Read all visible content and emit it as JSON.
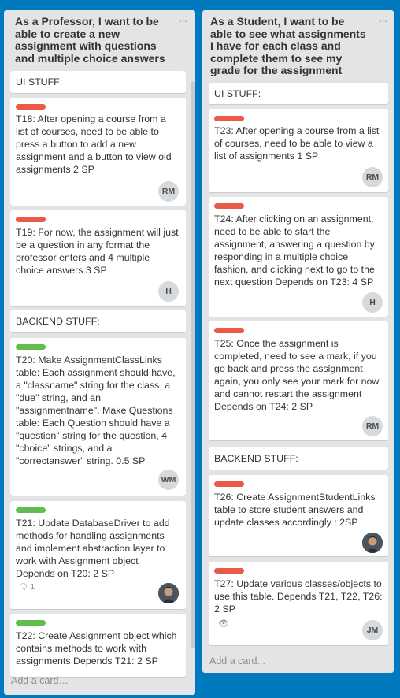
{
  "lists": [
    {
      "title": "As a Professor, I want to be able to create a new assignment with questions and multiple choice answers",
      "menu": "···",
      "cards": [
        {
          "title": "UI STUFF:"
        },
        {
          "title": "T18: After opening a course from a list of courses, need to be able to press a button to add a new assignment and a button to view old assignments 2 SP",
          "label_color": "#eb5a46",
          "avatar": "RM"
        },
        {
          "title": "T19: For now, the assignment will just be a question in any format the professor enters and 4 multiple choice answers 3 SP",
          "label_color": "#eb5a46",
          "avatar": "H"
        },
        {
          "title": "BACKEND STUFF:"
        },
        {
          "title": "T20: Make AssignmentClassLinks table: Each assignment should have, a \"classname\" string for the class, a \"due\" string, and an \"assignmentname\". Make Questions table: Each Question should have a \"question\" string for the question, 4 \"choice\" strings, and a \"correctanswer\" string. 0.5 SP",
          "label_color": "#61bd4f",
          "avatar": "WM"
        },
        {
          "title": "T21: Update DatabaseDriver to add methods for handling assignments and implement abstraction layer to work with Assignment object Depends on T20: 2 SP",
          "label_color": "#61bd4f",
          "comments": "1"
        },
        {
          "title": "T22: Create Assignment object which contains methods to work with assignments Depends T21: 2 SP",
          "label_color": "#61bd4f"
        }
      ],
      "add_card": "Add a card…"
    },
    {
      "title": "As a Student, I want to be able to see what assignments I have for each class and complete them to see my grade for the assignment",
      "menu": "···",
      "cards": [
        {
          "title": "UI STUFF:"
        },
        {
          "title": "T23: After opening a course from a list of courses, need to be able to view a list of assignments 1 SP",
          "label_color": "#eb5a46",
          "avatar": "RM"
        },
        {
          "title": "T24: After clicking on an assignment, need to be able to start the assignment, answering a question by responding in a multiple choice fashion, and clicking next to go to the next question Depends on T23: 4 SP",
          "label_color": "#eb5a46",
          "avatar": "H"
        },
        {
          "title": "T25: Once the assignment is completed, need to see a mark, if you go back and press the assignment again, you only see your mark for now and cannot restart the assignment Depends on T24: 2 SP",
          "label_color": "#eb5a46",
          "avatar": "RM"
        },
        {
          "title": "BACKEND STUFF:"
        },
        {
          "title": "T26: Create AssignmentStudentLinks table to store student answers and update classes accordingly : 2SP",
          "label_color": "#eb5a46"
        },
        {
          "title": "T27: Update various classes/objects to use this table. Depends T21, T22, T26: 2 SP",
          "label_color": "#eb5a46",
          "avatar": "JM"
        }
      ],
      "add_card": "Add a card..."
    }
  ]
}
